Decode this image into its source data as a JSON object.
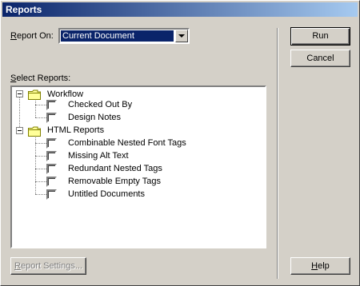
{
  "window": {
    "title": "Reports"
  },
  "report_on": {
    "label_prefix": "R",
    "label_rest": "eport On:",
    "selected": "Current Document"
  },
  "select_reports": {
    "label_prefix": "S",
    "label_rest": "elect Reports:"
  },
  "tree": {
    "groups": [
      {
        "label": "Workflow",
        "items": [
          "Checked Out By",
          "Design Notes"
        ]
      },
      {
        "label": "HTML Reports",
        "items": [
          "Combinable Nested Font Tags",
          "Missing Alt Text",
          "Redundant Nested Tags",
          "Removable Empty Tags",
          "Untitled Documents"
        ]
      }
    ]
  },
  "buttons": {
    "run": "Run",
    "cancel": "Cancel",
    "help_prefix": "H",
    "help_rest": "elp",
    "report_settings_prefix": "R",
    "report_settings_rest": "eport Settings..."
  },
  "colors": {
    "titlebar": "#0a246a",
    "face": "#d4d0c8",
    "selection": "#0a246a"
  },
  "icons": {
    "expander": "minus-box-icon",
    "folder": "folder-icon"
  }
}
